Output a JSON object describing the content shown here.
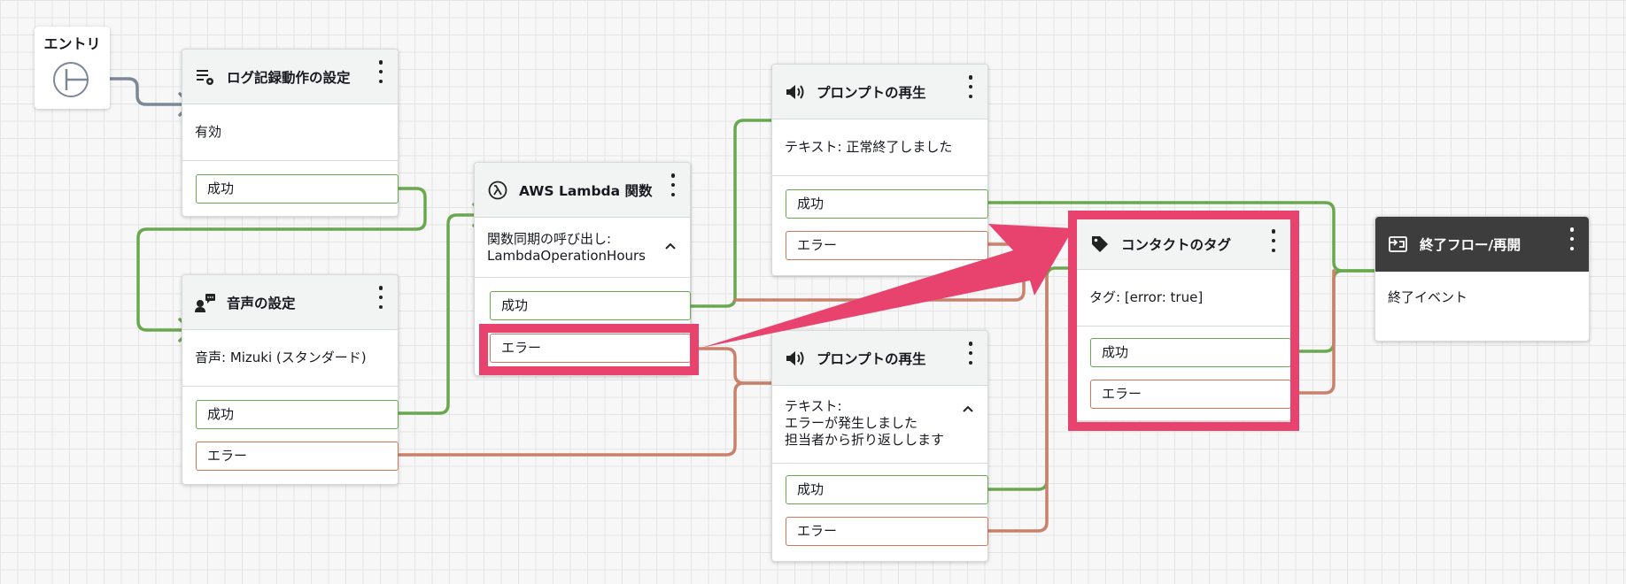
{
  "entry": {
    "label": "エントリ"
  },
  "nodes": {
    "logging": {
      "title": "ログ記録動作の設定",
      "body": "有効",
      "success": "成功"
    },
    "voice": {
      "title": "音声の設定",
      "body": "音声: Mizuki (スタンダード)",
      "success": "成功",
      "error": "エラー"
    },
    "lambda": {
      "title": "AWS Lambda 関数",
      "body_line1": "関数同期の呼び出し:",
      "body_line2": "LambdaOperationHours",
      "success": "成功",
      "error": "エラー"
    },
    "prompt1": {
      "title": "プロンプトの再生",
      "body": "テキスト: 正常終了しました",
      "success": "成功",
      "error": "エラー"
    },
    "prompt2": {
      "title": "プロンプトの再生",
      "body_line1": "テキスト:",
      "body_line2": "エラーが発生しました",
      "body_line3": "担当者から折り返しします",
      "success": "成功",
      "error": "エラー"
    },
    "tag": {
      "title": "コンタクトのタグ",
      "body": "タグ: [error: true]",
      "success": "成功",
      "error": "エラー"
    },
    "end": {
      "title": "終了フロー/再開",
      "body": "終了イベント"
    }
  },
  "icons": {
    "entry": "entry-start-icon",
    "logging": "logging-settings-icon",
    "voice": "voice-settings-icon",
    "lambda": "lambda-icon",
    "prompt": "speaker-icon",
    "tag": "tag-icon",
    "end": "end-flow-icon",
    "menu": "more-vertical-icon",
    "expand": "chevron-up-icon"
  },
  "colors": {
    "success_connector": "#6aa84f",
    "error_connector": "#c9816c",
    "entry_connector": "#7d8796",
    "highlight": "#e8436e",
    "end_header": "#3d3d3d"
  }
}
